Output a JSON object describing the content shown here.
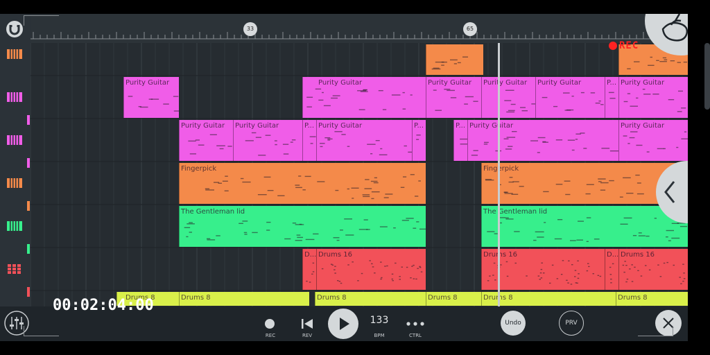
{
  "timeline": {
    "bar_markers": [
      "33",
      "65"
    ]
  },
  "recording": {
    "label": "REC",
    "color": "#ff2222"
  },
  "tracks": [
    {
      "name": "track-1",
      "icon": "piano-icon",
      "color": "#f48a4a"
    },
    {
      "name": "track-2",
      "icon": "piano-icon",
      "color": "#f05de8"
    },
    {
      "name": "track-3",
      "icon": "piano-icon",
      "color": "#f05de8"
    },
    {
      "name": "track-4",
      "icon": "piano-icon",
      "color": "#f48a4a"
    },
    {
      "name": "track-5",
      "icon": "piano-icon",
      "color": "#37ef8c"
    },
    {
      "name": "track-6",
      "icon": "drum-pad-icon",
      "color": "#f25159"
    }
  ],
  "clips": {
    "lane1": [
      {
        "label": "",
        "color": "#f48a4a"
      },
      {
        "label": "",
        "color": "#f48a4a"
      }
    ],
    "lane2": [
      {
        "label": "Purity Guitar",
        "color": "#f05de8"
      },
      {
        "label": "Purity Guitar",
        "color": "#f05de8"
      },
      {
        "label": "Purity Guitar",
        "color": "#f05de8"
      },
      {
        "label": "Purity Guitar",
        "color": "#f05de8"
      },
      {
        "label": "Purity Guitar",
        "color": "#f05de8"
      },
      {
        "label": "P...",
        "color": "#f05de8"
      },
      {
        "label": "Purity Guitar",
        "color": "#f05de8"
      }
    ],
    "lane3": [
      {
        "label": "Purity Guitar",
        "color": "#f05de8"
      },
      {
        "label": "Purity Guitar",
        "color": "#f05de8"
      },
      {
        "label": "P...",
        "color": "#f05de8"
      },
      {
        "label": "Purity Guitar",
        "color": "#f05de8"
      },
      {
        "label": "P...",
        "color": "#f05de8"
      },
      {
        "label": "P...",
        "color": "#f05de8"
      },
      {
        "label": "Purity Guitar",
        "color": "#f05de8"
      },
      {
        "label": "Purity Guitar",
        "color": "#f05de8"
      }
    ],
    "lane4": [
      {
        "label": "Fingerpick",
        "color": "#f48a4a"
      },
      {
        "label": "Fingerpick",
        "color": "#f48a4a"
      }
    ],
    "lane5": [
      {
        "label": "The Gentleman lid",
        "color": "#37ef8c"
      },
      {
        "label": "The Gentleman lid",
        "color": "#37ef8c"
      }
    ],
    "lane6": [
      {
        "label": "D...",
        "color": "#f25159"
      },
      {
        "label": "Drums 16",
        "color": "#f25159"
      },
      {
        "label": "Drums 16",
        "color": "#f25159"
      },
      {
        "label": "D...",
        "color": "#f25159"
      },
      {
        "label": "Drums 16",
        "color": "#f25159"
      }
    ],
    "lane7": [
      {
        "label": "Drums 8",
        "color": "#d9f04a"
      },
      {
        "label": "Drums 8",
        "color": "#d9f04a"
      },
      {
        "label": "Drums 8",
        "color": "#d9f04a"
      },
      {
        "label": "Drums 8",
        "color": "#d9f04a"
      },
      {
        "label": "Drums 8",
        "color": "#d9f04a"
      },
      {
        "label": "Drums 8",
        "color": "#d9f04a"
      }
    ]
  },
  "transport": {
    "time": "00:02:04:00",
    "rec_label": "REC",
    "rev_label": "REV",
    "tempo": "133",
    "bpm_label": "BPM",
    "ctrl_label": "CTRL",
    "undo_label": "Undo",
    "prv_label": "PRV"
  }
}
